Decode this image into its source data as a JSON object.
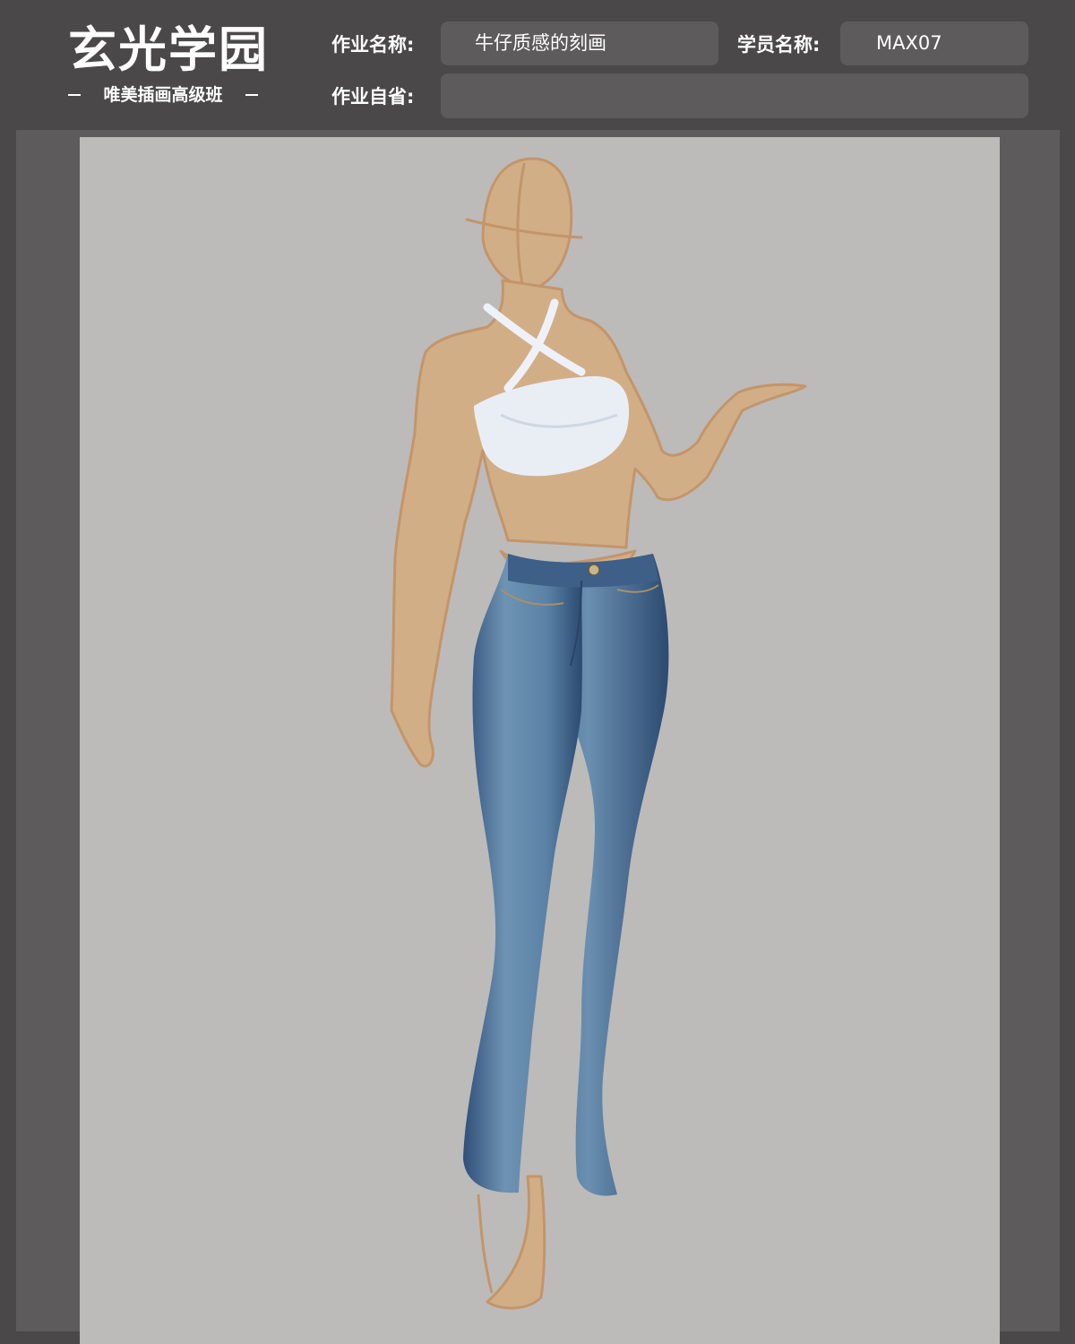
{
  "logo": {
    "title": "玄光学园",
    "subtitle": "唯美插画高级班"
  },
  "form": {
    "assignment_name_label": "作业名称:",
    "assignment_name_value": "牛仔质感的刻画",
    "student_name_label": "学员名称:",
    "student_name_value": "MAX07",
    "self_review_label": "作业自省:",
    "self_review_value": ""
  },
  "colors": {
    "header_bg": "#4a4849",
    "field_bg": "#5d5b5c",
    "paper_bg": "#bcbbba",
    "skin": "#d2ae87",
    "sketch_line": "#c3956a",
    "denim_light": "#6f94b4",
    "denim_dark": "#2d4b72",
    "top_white": "#e9eef5"
  },
  "artwork": {
    "subject": "fashion-figure-in-jeans-and-white-halter-top"
  }
}
